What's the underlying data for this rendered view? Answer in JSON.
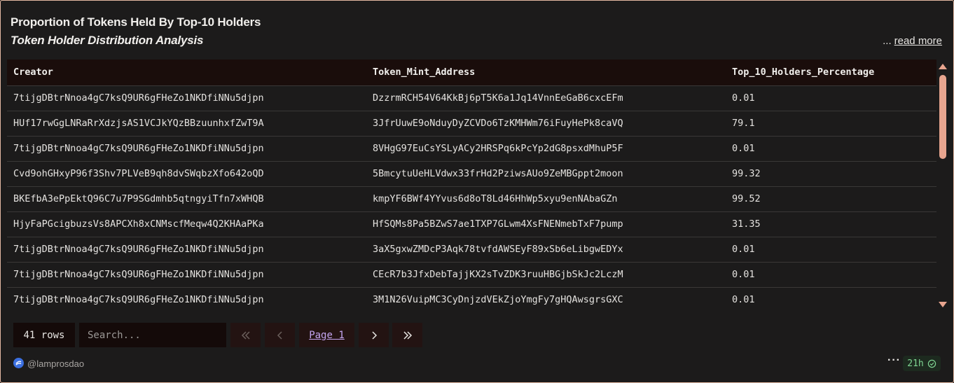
{
  "header": {
    "title": "Proportion of Tokens Held By Top-10 Holders",
    "subtitle": "Token Holder Distribution Analysis",
    "read_more_dots": "...",
    "read_more": "read more"
  },
  "table": {
    "columns": [
      "Creator",
      "Token_Mint_Address",
      "Top_10_Holders_Percentage"
    ],
    "rows": [
      [
        "7tijgDBtrNnoa4gC7ksQ9UR6gFHeZo1NKDfiNNu5djpn",
        "DzzrmRCH54V64KkBj6pT5K6a1Jq14VnnEeGaB6cxcEFm",
        "0.01"
      ],
      [
        "HUf17rwGgLNRaRrXdzjsAS1VCJkYQzBBzuunhxfZwT9A",
        "3JfrUuwE9oNduyDyZCVDo6TzKMHWm76iFuyHePk8caVQ",
        "79.1"
      ],
      [
        "7tijgDBtrNnoa4gC7ksQ9UR6gFHeZo1NKDfiNNu5djpn",
        "8VHgG97EuCsYSLyACy2HRSPq6kPcYp2dG8psxdMhuP5F",
        "0.01"
      ],
      [
        "Cvd9ohGHxyP96f3Shv7PLVeB9qh8dvSWqbzXfo642oQD",
        "5BmcytuUeHLVdwx33frHd2PziwsAUo9ZeMBGppt2moon",
        "99.32"
      ],
      [
        "BKEfbA3ePpEktQ96C7u7P9SGdmhb5qtngyiTfn7xWHQB",
        "kmpYF6BWf4YYvus6d8oT8Ld46HhWp5xyu9enNAbaGZn",
        "99.52"
      ],
      [
        "HjyFaPGcigbuzsVs8APCXh8xCNMscfMeqw4Q2KHAaPKa",
        "HfSQMs8Pa5BZwS7ae1TXP7GLwm4XsFNENmebTxF7pump",
        "31.35"
      ],
      [
        "7tijgDBtrNnoa4gC7ksQ9UR6gFHeZo1NKDfiNNu5djpn",
        "3aX5gxwZMDcP3Aqk78tvfdAWSEyF89xSb6eLibgwEDYx",
        "0.01"
      ],
      [
        "7tijgDBtrNnoa4gC7ksQ9UR6gFHeZo1NKDfiNNu5djpn",
        "CEcR7b3JfxDebTajjKX2sTvZDK3ruuHBGjbSkJc2LczM",
        "0.01"
      ],
      [
        "7tijgDBtrNnoa4gC7ksQ9UR6gFHeZo1NKDfiNNu5djpn",
        "3M1N26VuipMC3CyDnjzdVEkZjoYmgFy7gHQAwsgrsGXC",
        "0.01"
      ]
    ]
  },
  "pagination": {
    "rows_count": "41 rows",
    "search_placeholder": "Search...",
    "page_label": "Page 1"
  },
  "footer": {
    "username": "@lamprosdao",
    "more_dots": "···",
    "refresh_age": "21h"
  },
  "colors": {
    "accent": "#e8a58f",
    "card_border": "#e3b8a2",
    "link_purple": "#c4a5f0",
    "badge_green": "#7fd492",
    "header_row_bg": "#1a0d0b"
  },
  "icons": [
    "chevron-double-left-icon",
    "chevron-left-icon",
    "chevron-right-icon",
    "chevron-double-right-icon",
    "dune-logo-icon",
    "check-circle-icon"
  ]
}
